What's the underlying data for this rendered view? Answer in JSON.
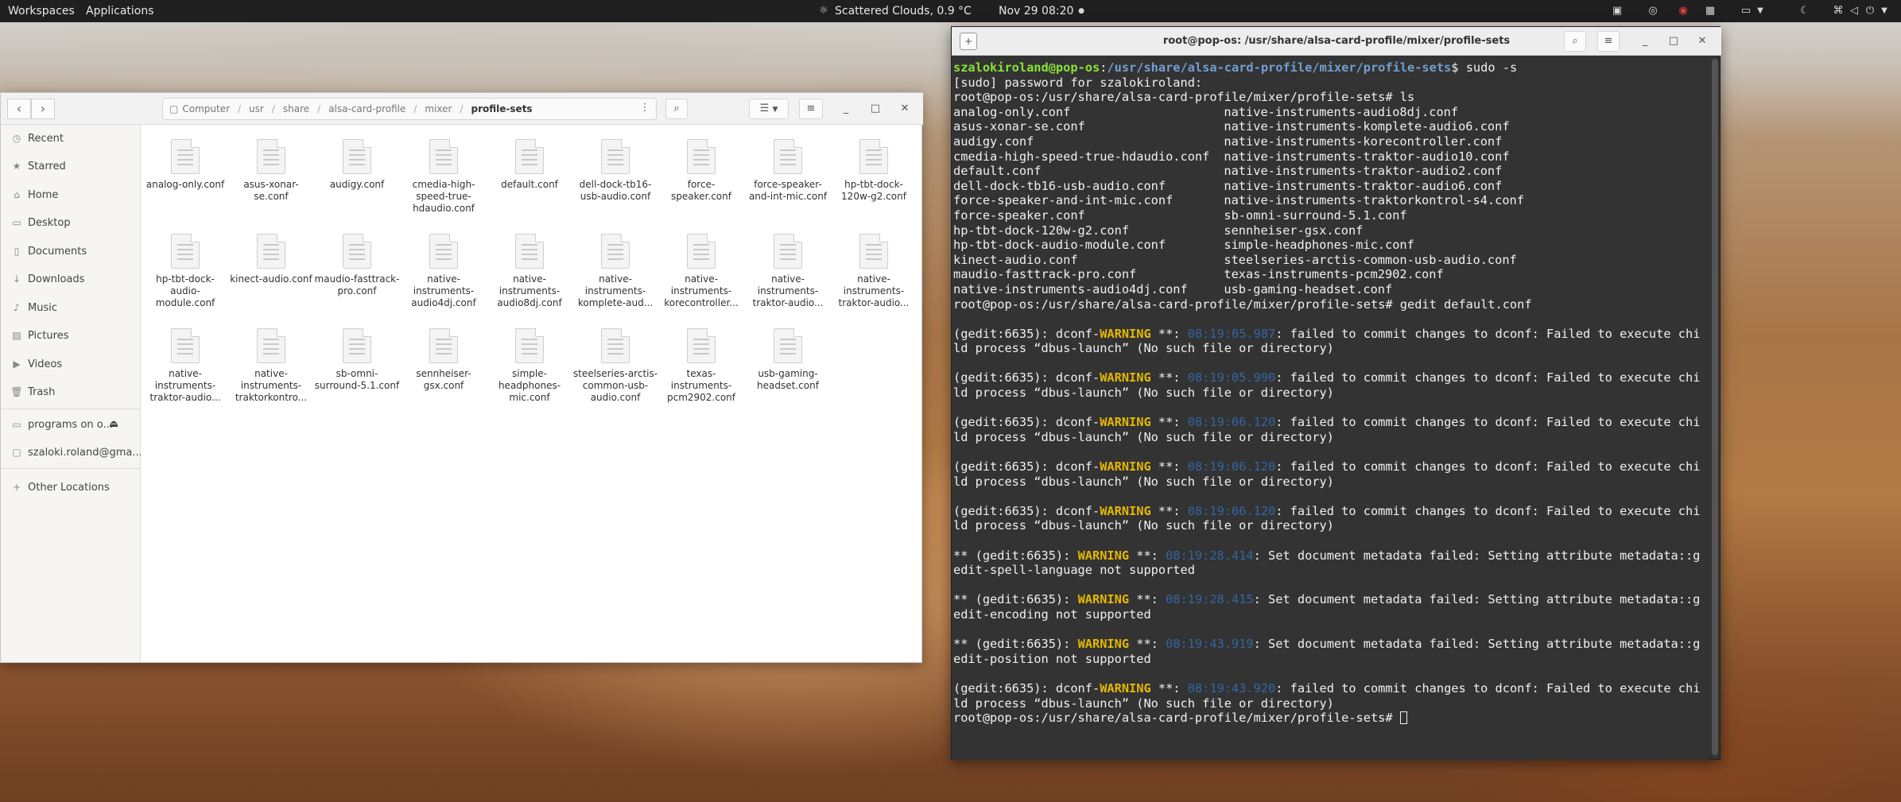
{
  "topbar": {
    "workspaces": "Workspaces",
    "applications": "Applications",
    "weather": "Scattered Clouds, 0.9 °C",
    "datetime": "Nov 29  08:20"
  },
  "files": {
    "title_crumbs": [
      "Computer",
      "usr",
      "share",
      "alsa-card-profile",
      "mixer",
      "profile-sets"
    ],
    "sidebar": [
      "Recent",
      "Starred",
      "Home",
      "Desktop",
      "Documents",
      "Downloads",
      "Music",
      "Pictures",
      "Videos",
      "Trash",
      "programs on o...",
      "szaloki.roland@gma...",
      "Other Locations"
    ],
    "items": [
      "analog-only.conf",
      "asus-xonar-se.conf",
      "audigy.conf",
      "cmedia-high-speed-true-hdaudio.conf",
      "default.conf",
      "dell-dock-tb16-usb-audio.conf",
      "force-speaker.conf",
      "force-speaker-and-int-mic.conf",
      "hp-tbt-dock-120w-g2.conf",
      "hp-tbt-dock-audio-module.conf",
      "kinect-audio.conf",
      "maudio-fasttrack-pro.conf",
      "native-instruments-audio4dj.conf",
      "native-instruments-audio8dj.conf",
      "native-instruments-komplete-aud...",
      "native-instruments-korecontroller...",
      "native-instruments-traktor-audio...",
      "native-instruments-traktor-audio...",
      "native-instruments-traktor-audio...",
      "native-instruments-traktorkontro...",
      "sb-omni-surround-5.1.conf",
      "sennheiser-gsx.conf",
      "simple-headphones-mic.conf",
      "steelseries-arctis-common-usb-audio.conf",
      "texas-instruments-pcm2902.conf",
      "usb-gaming-headset.conf"
    ]
  },
  "terminal": {
    "title": "root@pop-os: /usr/share/alsa-card-profile/mixer/profile-sets",
    "prompt_user": "szalokiroland@pop-os",
    "prompt_path": "/usr/share/alsa-card-profile/mixer/profile-sets",
    "cmd1": "$ sudo -s",
    "sudo": "[sudo] password for szalokiroland:",
    "root_prompt": "root@pop-os:/usr/share/alsa-card-profile/mixer/profile-sets# ",
    "cmd2": "ls",
    "ls_left": [
      "analog-only.conf",
      "asus-xonar-se.conf",
      "audigy.conf",
      "cmedia-high-speed-true-hdaudio.conf",
      "default.conf",
      "dell-dock-tb16-usb-audio.conf",
      "force-speaker-and-int-mic.conf",
      "force-speaker.conf",
      "hp-tbt-dock-120w-g2.conf",
      "hp-tbt-dock-audio-module.conf",
      "kinect-audio.conf",
      "maudio-fasttrack-pro.conf",
      "native-instruments-audio4dj.conf"
    ],
    "ls_right": [
      "native-instruments-audio8dj.conf",
      "native-instruments-komplete-audio6.conf",
      "native-instruments-korecontroller.conf",
      "native-instruments-traktor-audio10.conf",
      "native-instruments-traktor-audio2.conf",
      "native-instruments-traktor-audio6.conf",
      "native-instruments-traktorkontrol-s4.conf",
      "sb-omni-surround-5.1.conf",
      "sennheiser-gsx.conf",
      "simple-headphones-mic.conf",
      "steelseries-arctis-common-usb-audio.conf",
      "texas-instruments-pcm2902.conf",
      "usb-gaming-headset.conf"
    ],
    "cmd3": "gedit default.conf",
    "dconf_pre": "(gedit:6635): dconf-",
    "warning": "WARNING",
    "stars": " **: ",
    "dconf_msg": ": failed to commit changes to dconf: Failed to execute chi",
    "dconf_cont": "ld process “dbus-launch” (No such file or directory)",
    "meta_pre": "** (gedit:6635): ",
    "meta_msg": ": Set document metadata failed: Setting attribute metadata::g",
    "times_dconf": [
      "08:19:05.987",
      "08:19:05.990",
      "08:19:06.120",
      "08:19:06.120",
      "08:19:06.120"
    ],
    "times_meta": [
      "08:19:28.414",
      "08:19:28.415",
      "08:19:43.919"
    ],
    "meta_cont": [
      "edit-spell-language not supported",
      "edit-encoding not supported",
      "edit-position not supported"
    ],
    "time_last": "08:19:43.920"
  }
}
